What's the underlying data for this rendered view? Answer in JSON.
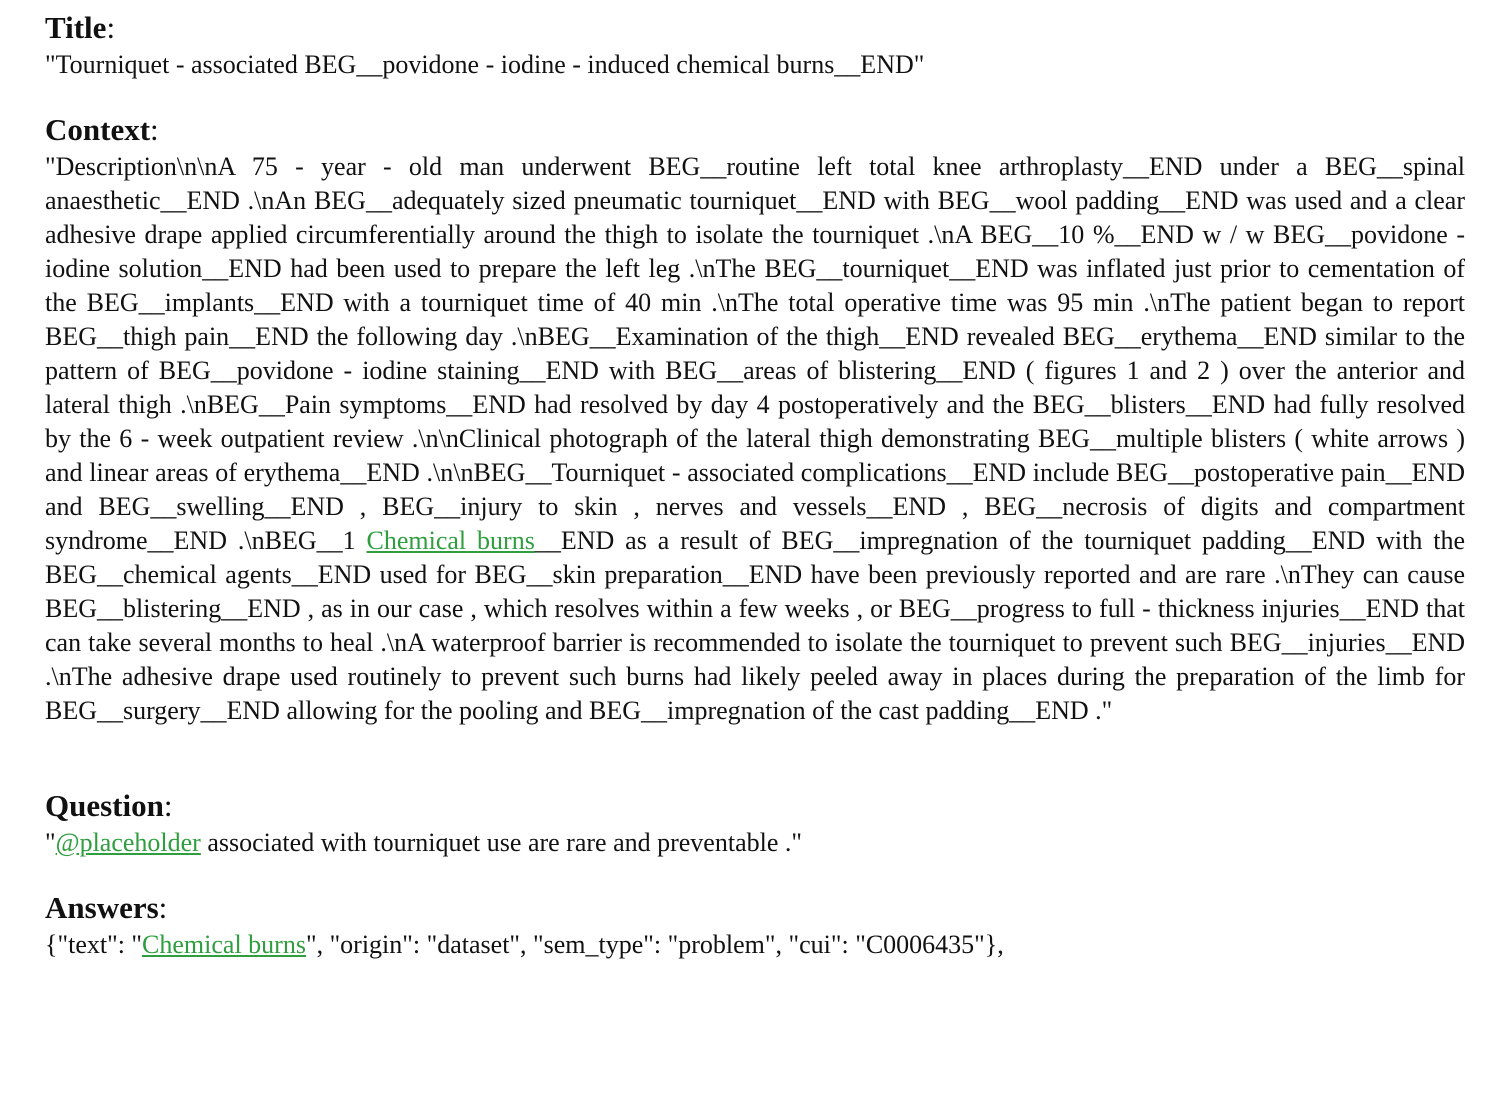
{
  "title": {
    "heading": "Title",
    "colon": ":",
    "text": "\"Tourniquet - associated BEG__povidone - iodine - induced chemical burns__END\""
  },
  "context": {
    "heading": "Context",
    "colon": ":",
    "part1": "\"Description\\n\\nA 75 - year - old man underwent BEG__routine left total knee arthroplasty__END under a BEG__spinal anaesthetic__END .\\nAn BEG__adequately sized pneumatic tourniquet__END with BEG__wool padding__END was used and a clear adhesive drape applied circumferentially around the thigh to isolate the tourniquet .\\nA BEG__10 %__END w / w BEG__povidone - iodine solution__END had been used to prepare the left leg .\\nThe BEG__tourniquet__END was inflated just prior to cementation of the BEG__implants__END with a tourniquet time of 40 min .\\nThe total operative time was 95 min .\\nThe patient began to report BEG__thigh pain__END the following day .\\nBEG__Examination of the thigh__END revealed BEG__erythema__END similar to the pattern of BEG__povidone - iodine staining__END with BEG__areas of blistering__END ( figures 1 and 2 ) over the anterior and lateral thigh .\\nBEG__Pain symptoms__END had resolved by day 4 postoperatively and the BEG__blisters__END had fully resolved by the 6 - week outpatient review .\\n\\nClinical photograph of the lateral thigh demonstrating BEG__multiple blisters ( white arrows ) and linear areas of erythema__END .\\n\\nBEG__Tourniquet - associated complications__END include BEG__postoperative pain__END and BEG__swelling__END , BEG__injury to skin , nerves and vessels__END , BEG__necrosis of digits and compartment syndrome__END .\\nBEG__1 ",
    "highlight": "Chemical burns",
    "part2": "__END as a result of BEG__impregnation of the tourniquet padding__END with the BEG__chemical agents__END used for BEG__skin preparation__END have been previously reported and are rare .\\nThey can cause BEG__blistering__END , as in our case , which resolves within a few weeks , or BEG__progress to full - thickness injuries__END that can take several months to heal .\\nA waterproof barrier is recommended to isolate the tourniquet to prevent such BEG__injuries__END .\\nThe adhesive drape used routinely to prevent such burns had likely peeled away in places during the preparation of the limb for BEG__surgery__END allowing for the pooling and BEG__impregnation of the cast padding__END .\""
  },
  "question": {
    "heading": "Question",
    "colon": ":",
    "prefix": "\"",
    "placeholder": "@placeholder",
    "suffix": " associated with tourniquet use are rare and preventable .\""
  },
  "answers": {
    "heading": "Answers",
    "colon": ":",
    "prefix": "{\"text\": \"",
    "answer_text": "Chemical burns",
    "suffix": "\", \"origin\": \"dataset\", \"sem_type\": \"problem\", \"cui\": \"C0006435\"},"
  },
  "colors": {
    "highlight": "#2f9e3f",
    "text": "#111111"
  }
}
